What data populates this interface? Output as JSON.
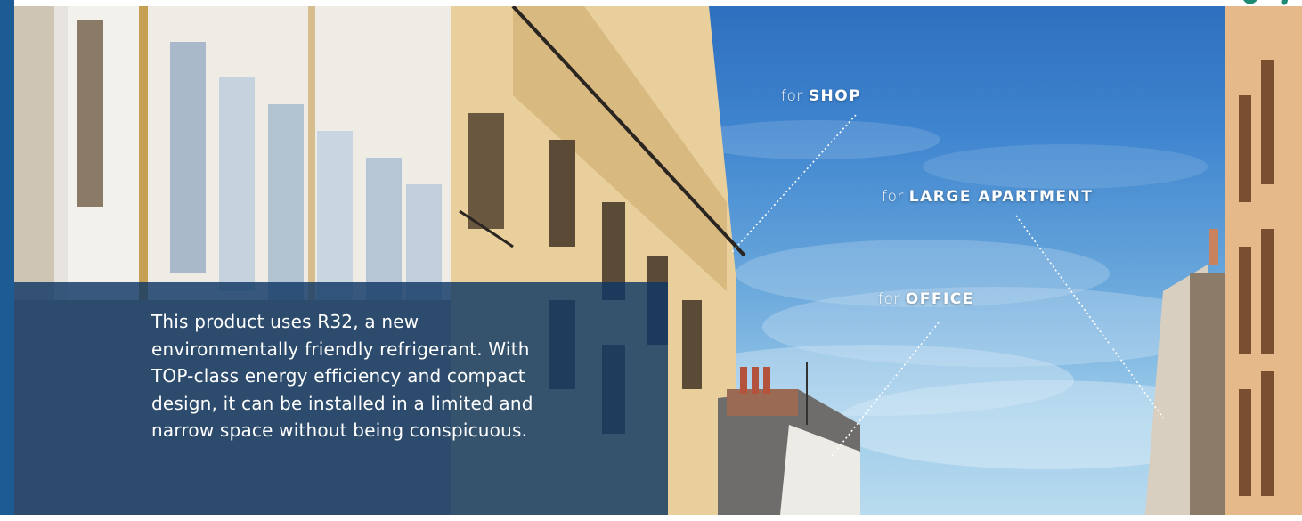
{
  "callouts": {
    "shop": {
      "prefix": "for",
      "keyword": "SHOP"
    },
    "large_apartment": {
      "prefix": "for",
      "keyword": "LARGE APARTMENT"
    },
    "office": {
      "prefix": "for",
      "keyword": "OFFICE"
    }
  },
  "description": {
    "lines": [
      "This product uses R32, a new",
      "environmentally friendly refrigerant. With",
      "TOP-class energy efficiency and compact",
      "design, it can be installed in a limited and",
      "narrow space without being conspicuous."
    ]
  },
  "colors": {
    "panel": "#0f3764",
    "left_strip": "#1c5b93",
    "sky_top": "#2f6fbf",
    "sky_bottom": "#b9dbef",
    "brand": "#1e8a74"
  },
  "icons": {
    "brand": "brand-logo-fragment"
  }
}
